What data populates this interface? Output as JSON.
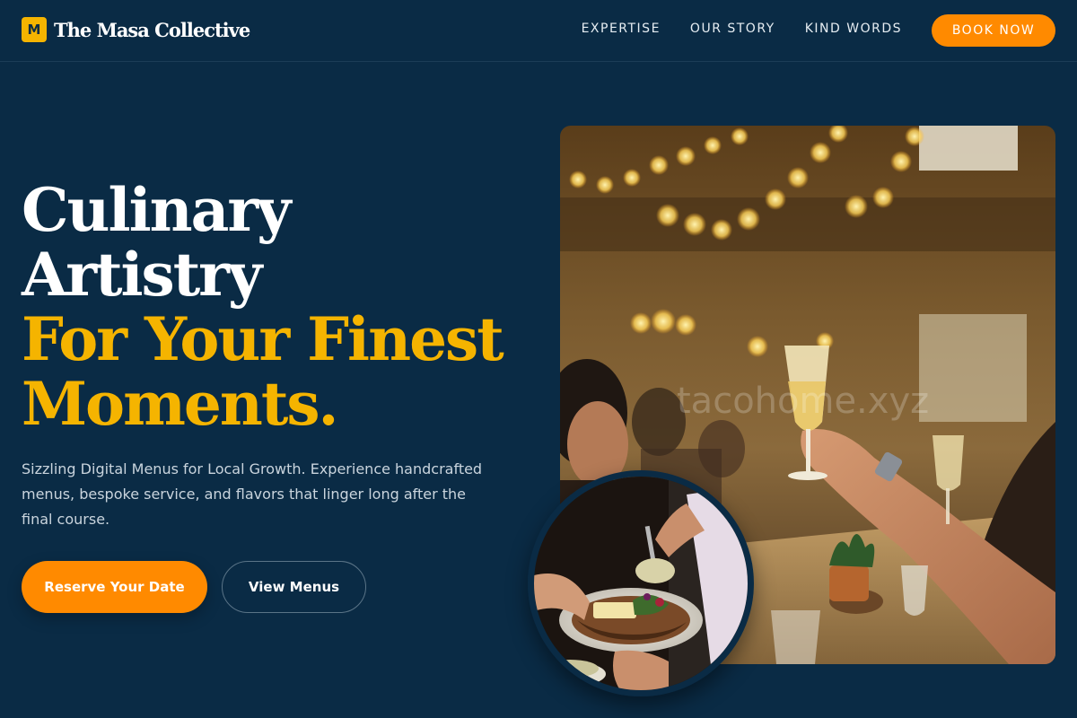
{
  "brand": {
    "badge_letter": "M",
    "name": "The Masa Collective"
  },
  "nav": {
    "links": [
      "EXPERTISE",
      "OUR STORY",
      "KIND WORDS"
    ],
    "cta_label": "BOOK NOW"
  },
  "hero": {
    "headline_white": [
      "Culinary",
      "Artistry"
    ],
    "headline_gold": [
      "For Your Finest",
      "Moments."
    ],
    "subtext": "Sizzling Digital Menus for Local Growth. Experience handcrafted menus, bespoke service, and flavors that linger long after the final course.",
    "primary_cta": "Reserve Your Date",
    "secondary_cta": "View Menus"
  },
  "images": {
    "main_photo": "banquet-toast-photo",
    "circle_photo": "plated-dish-photo",
    "watermark": "tacohome.xyz"
  },
  "colors": {
    "background": "#0a2b45",
    "accent_orange": "#ff8a00",
    "accent_gold": "#f5b400",
    "body_text": "#c9d4dd"
  }
}
